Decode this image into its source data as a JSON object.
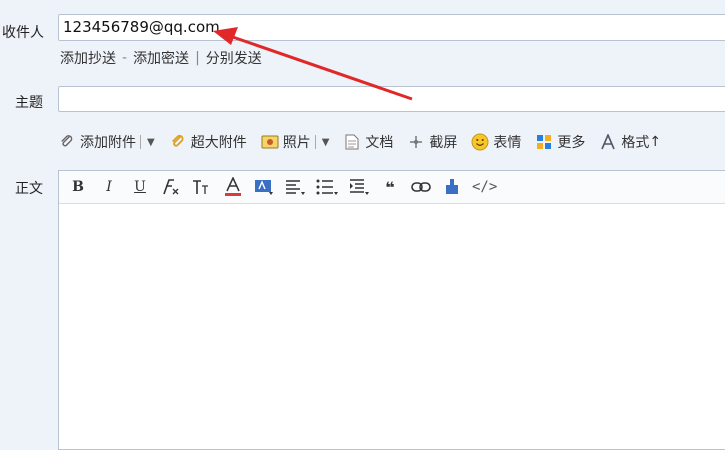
{
  "labels": {
    "recipient": "收件人",
    "subject": "主题",
    "body": "正文"
  },
  "recipient_value": "123456789@qq.com",
  "links": {
    "cc": "添加抄送",
    "bcc": "添加密送",
    "separate": "分别发送",
    "sep1": "-",
    "sep2": "|"
  },
  "toolbar": {
    "attach": "添加附件",
    "large_attach": "超大附件",
    "photo": "照片",
    "document": "文档",
    "screenshot": "截屏",
    "emoji": "表情",
    "more": "更多",
    "format": "格式"
  },
  "format_bar": {
    "bold": "B",
    "italic": "I",
    "underline": "U",
    "html_code": "</>"
  },
  "colors": {
    "annotation_arrow": "#e02828",
    "font_color_underline": "#d83b3b"
  }
}
